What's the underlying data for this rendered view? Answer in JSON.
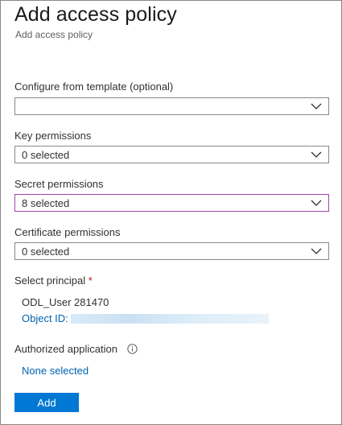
{
  "header": {
    "title": "Add access policy",
    "subtitle": "Add access policy"
  },
  "form": {
    "template": {
      "label": "Configure from template (optional)",
      "value": ""
    },
    "key_permissions": {
      "label": "Key permissions",
      "value": "0 selected"
    },
    "secret_permissions": {
      "label": "Secret permissions",
      "value": "8 selected"
    },
    "certificate_permissions": {
      "label": "Certificate permissions",
      "value": "0 selected"
    },
    "principal": {
      "label": "Select principal",
      "required_marker": "*",
      "name": "ODL_User 281470",
      "object_id_label": "Object ID:"
    },
    "authorized_application": {
      "label": "Authorized application",
      "link": "None selected"
    },
    "add_button": "Add"
  },
  "colors": {
    "accent": "#0078d4",
    "link": "#0063b1",
    "focus_border": "#a146a5",
    "required": "#c50f1f"
  }
}
